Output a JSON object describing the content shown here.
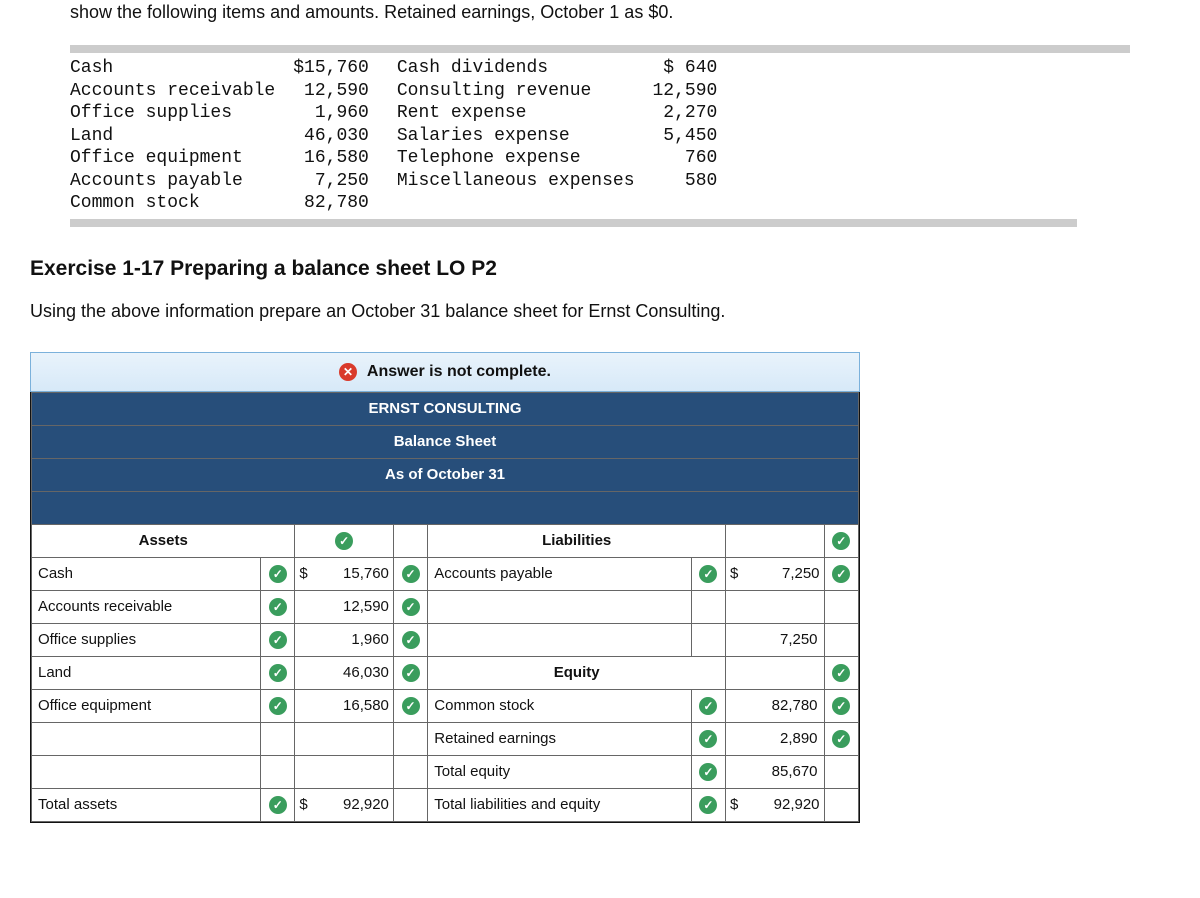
{
  "intro_line_partial": "show the following items and amounts. Retained earnings, October 1 as  $0.",
  "ledger": {
    "left": [
      {
        "label": "Cash",
        "amount": "$15,760"
      },
      {
        "label": "Accounts receivable",
        "amount": "12,590"
      },
      {
        "label": "Office supplies",
        "amount": "1,960"
      },
      {
        "label": "Land",
        "amount": "46,030"
      },
      {
        "label": "Office equipment",
        "amount": "16,580"
      },
      {
        "label": "Accounts payable",
        "amount": "7,250"
      },
      {
        "label": "Common stock",
        "amount": "82,780"
      }
    ],
    "right": [
      {
        "label": "Cash dividends",
        "amount": "$   640"
      },
      {
        "label": "Consulting revenue",
        "amount": "12,590"
      },
      {
        "label": "Rent expense",
        "amount": "2,270"
      },
      {
        "label": "Salaries expense",
        "amount": "5,450"
      },
      {
        "label": "Telephone expense",
        "amount": "760"
      },
      {
        "label": "Miscellaneous expenses",
        "amount": "580"
      }
    ]
  },
  "exercise_title": "Exercise 1-17 Preparing a balance sheet LO P2",
  "exercise_sub": "Using the above information prepare an October 31 balance sheet for Ernst Consulting.",
  "banner": "Answer is not complete.",
  "bs": {
    "company": "ERNST CONSULTING",
    "title": "Balance Sheet",
    "date": "As of October 31",
    "assets_header": "Assets",
    "liab_header": "Liabilities",
    "equity_header": "Equity",
    "assets": [
      {
        "label": "Cash",
        "cur": "$",
        "amount": "15,760"
      },
      {
        "label": "Accounts receivable",
        "cur": "",
        "amount": "12,590"
      },
      {
        "label": "Office supplies",
        "cur": "",
        "amount": "1,960"
      },
      {
        "label": "Land",
        "cur": "",
        "amount": "46,030"
      },
      {
        "label": "Office equipment",
        "cur": "",
        "amount": "16,580"
      }
    ],
    "total_assets_label": "Total assets",
    "total_assets_cur": "$",
    "total_assets": "92,920",
    "liabilities": [
      {
        "label": "Accounts payable",
        "cur": "$",
        "amount": "7,250"
      }
    ],
    "liab_subtotal": "7,250",
    "equity": [
      {
        "label": "Common stock",
        "amount": "82,780"
      },
      {
        "label": "Retained earnings",
        "amount": "2,890"
      }
    ],
    "total_equity_label": "Total equity",
    "total_equity": "85,670",
    "total_le_label": "Total liabilities and equity",
    "total_le_cur": "$",
    "total_le": "92,920"
  }
}
